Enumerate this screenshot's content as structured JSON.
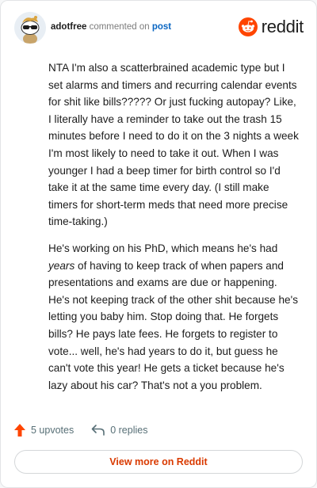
{
  "header": {
    "username": "adotfree",
    "verb": "commented on",
    "post_link": "post",
    "brand": "reddit"
  },
  "comment": {
    "p1": "NTA I'm also a scatterbrained academic type but I set alarms and timers and recurring calendar events for shit like bills????? Or just fucking autopay? Like, I literally have a reminder to take out the trash 15 minutes before I need to do it on the 3 nights a week I'm most likely to need to take it out. When I was younger I had a beep timer for birth control so I'd take it at the same time every day. (I still make timers for short-term meds that need more precise time-taking.)",
    "p2_before": "He's working on his PhD, which means he's had ",
    "p2_em": "years",
    "p2_after": " of having to keep track of when papers and presentations and exams are due or happening. He's not keeping track of the other shit because he's letting you baby him. Stop doing that. He forgets bills? He pays late fees. He forgets to register to vote... well, he's had years to do it, but guess he can't vote this year! He gets a ticket because he's lazy about his car? That's not a you problem."
  },
  "actions": {
    "upvotes": "5 upvotes",
    "replies": "0 replies"
  },
  "footer": {
    "view_more": "View more on Reddit"
  },
  "colors": {
    "brand_orange": "#ff4500",
    "link_blue": "#0a66c2",
    "cta_text": "#d93a00"
  },
  "icons": [
    "user-avatar-icon",
    "reddit-snoo-icon",
    "upvote-arrow-icon",
    "reply-arrow-icon"
  ]
}
